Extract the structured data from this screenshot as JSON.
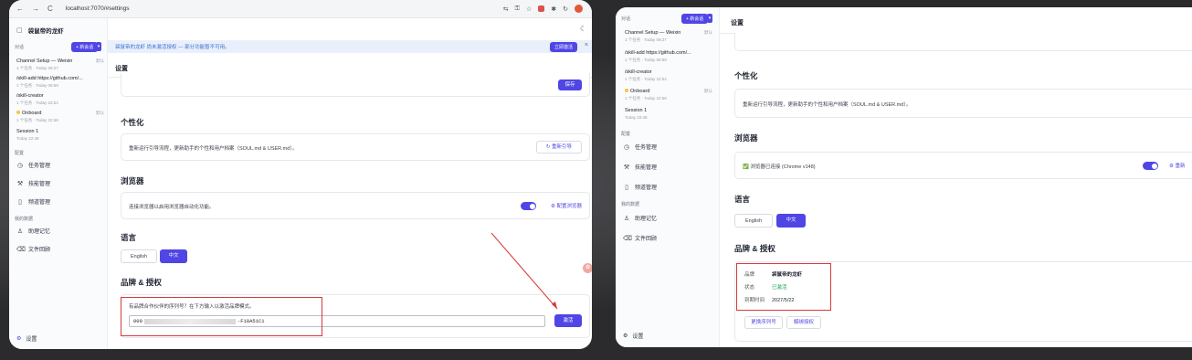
{
  "browser": {
    "url": "localhost:7070/#settings",
    "nav_back": "←",
    "nav_forward": "→",
    "nav_reload": "C"
  },
  "sidebar": {
    "app_title": "袋鼠帝的龙虾",
    "conversations_label": "对话",
    "new_session": "+ 新会话",
    "sessions": [
      {
        "title": "Channel Setup — Weixin",
        "meta": "1 个任务 · Today 09:27",
        "tag": "默认"
      },
      {
        "title": "/skill-add https://github.com/...",
        "meta": "1 个任务 · Today 09:69"
      },
      {
        "title": "/skill-creator",
        "meta": "1 个任务 · Today 22:54"
      },
      {
        "title": "Onboard",
        "meta": "1 个任务 · Today 22:58",
        "tag": "默认"
      },
      {
        "title": "Session 1",
        "meta": "Today 22:48"
      }
    ],
    "config_label": "配置",
    "config_items": [
      "任务管理",
      "技能管理",
      "频道管理"
    ],
    "my_data_label": "我的数据",
    "data_items": [
      "助理记忆",
      "文件回顾"
    ],
    "settings": "设置"
  },
  "banner": {
    "text": "袋鼠帝的龙虾 尚未激活授权 — 部分功能暂不可用。",
    "action": "立即激活",
    "close": "×"
  },
  "page_title": "设置",
  "save_button": "保存",
  "personalization": {
    "title": "个性化",
    "desc": "重新运行引导流程，更新助手的个性和用户档案（SOUL.md & USER.md）。",
    "button": "↻ 重新引导"
  },
  "browser_section": {
    "title": "浏览器",
    "desc_a": "连接浏览器以启用浏览器自动化功能。",
    "config_link": "⚙ 配置浏览器",
    "desc_b": "✅ 浏览器已连接 (Chrome v148)",
    "reconnect_link": "⚙ 重新"
  },
  "language": {
    "title": "语言",
    "options": [
      "English",
      "中文"
    ],
    "selected": "中文"
  },
  "brand": {
    "title": "品牌 & 授权",
    "prompt": "有品牌合作伙伴的序列号？在下方输入以激活品牌模式。",
    "serial_prefix": "000",
    "serial_suffix": "-F10A51C1",
    "activate": "激活",
    "labels": {
      "brand": "品牌",
      "status": "状态",
      "expiry": "到期时间"
    },
    "values": {
      "brand": "袋鼠帝的龙虾",
      "status": "已激活",
      "expiry": "2027/5/22"
    },
    "change_serial": "更换序列号",
    "unbind": "解绑授权"
  },
  "icons": [
    "task-icon",
    "skill-icon",
    "channel-icon",
    "memory-icon",
    "file-icon",
    "settings-icon"
  ],
  "colors": {
    "accent": "#4f46e5",
    "success": "#16a34a",
    "annotation": "#d63a3a"
  }
}
